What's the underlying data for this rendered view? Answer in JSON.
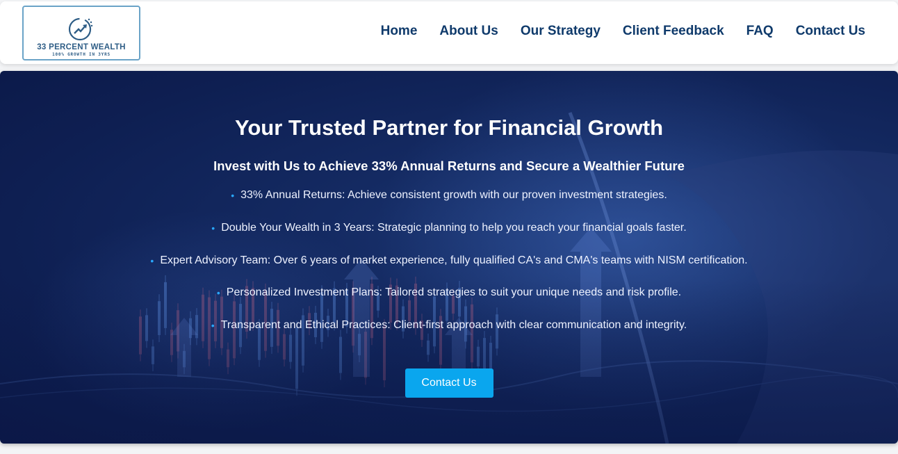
{
  "brand": {
    "name": "33 PERCENT WEALTH",
    "tagline": "100% GROWTH IN 3YRS"
  },
  "nav": {
    "items": [
      "Home",
      "About Us",
      "Our Strategy",
      "Client Feedback",
      "FAQ",
      "Contact Us"
    ]
  },
  "hero": {
    "title": "Your Trusted Partner for Financial Growth",
    "subtitle": "Invest with Us to Achieve 33% Annual Returns and Secure a Wealthier Future",
    "features": [
      "33% Annual Returns: Achieve consistent growth with our proven investment strategies.",
      "Double Your Wealth in 3 Years: Strategic planning to help you reach your financial goals faster.",
      "Expert Advisory Team: Over 6 years of market experience, fully qualified CA's and CMA's teams with NISM certification.",
      "Personalized Investment Plans: Tailored strategies to suit your unique needs and risk profile.",
      "Transparent and Ethical Practices: Client-first approach with clear communication and integrity."
    ],
    "cta_label": "Contact Us"
  },
  "colors": {
    "nav_text": "#0f3a6b",
    "hero_bg": "#0e1f52",
    "accent": "#0aa6ee",
    "bullet": "#29a8ff"
  }
}
